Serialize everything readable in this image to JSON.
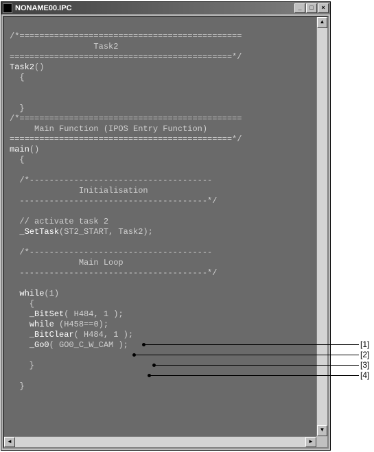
{
  "window": {
    "title": "NONAME00.IPC",
    "min_tip": "Minimize",
    "max_tip": "Maximize",
    "close_tip": "Close"
  },
  "code": {
    "l00": "",
    "l01": "/*=============================================",
    "l02": "                 Task2",
    "l03": "=============================================*/",
    "l04f": "Task2",
    "l04r": "()",
    "l05": "  {",
    "l06": "",
    "l07": "",
    "l08": "  }",
    "l09": "/*=============================================",
    "l10": "     Main Function (IPOS Entry Function)",
    "l11": "=============================================*/",
    "l12f": "main",
    "l12r": "()",
    "l13": "  {",
    "l14": "",
    "l15": "  /*-------------------------------------",
    "l16": "              Initialisation",
    "l17": "  --------------------------------------*/",
    "l18": "",
    "l19": "  // activate task 2",
    "l20p": "  ",
    "l20f": "_SetTask",
    "l20r": "(ST2_START, Task2);",
    "l21": "",
    "l22": "  /*-------------------------------------",
    "l23": "              Main Loop",
    "l24": "  --------------------------------------*/",
    "l25": "",
    "l26p": "  ",
    "l26k": "while",
    "l26r": "(1)",
    "l27": "    {",
    "l28p": "    ",
    "l28f": "_BitSet",
    "l28r": "( H484, 1 );",
    "l29p": "    ",
    "l29k": "while",
    "l29r": " (H458==0);",
    "l30p": "    ",
    "l30f": "_BitClear",
    "l30r": "( H484, 1 );",
    "l31p": "    ",
    "l31f": "_Go0",
    "l31r": "( GO0_C_W_CAM );",
    "l32": "",
    "l33": "    }",
    "l34": "",
    "l35": "  }"
  },
  "callouts": {
    "c1": "[1]",
    "c2": "[2]",
    "c3": "[3]",
    "c4": "[4]"
  },
  "scroll": {
    "up": "▲",
    "down": "▼",
    "left": "◄",
    "right": "►"
  }
}
